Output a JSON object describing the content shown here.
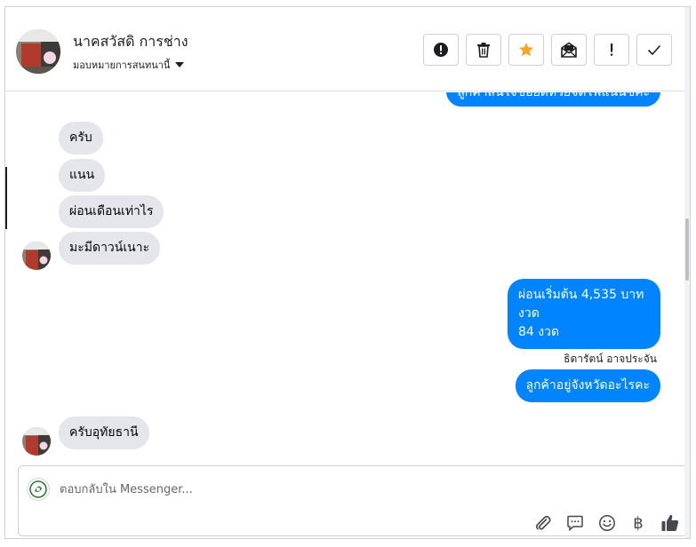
{
  "header": {
    "contact_name": "นาคสวัสดิ การช่าง",
    "assign_label": "มอบหมายการสนทนานี้",
    "tools": [
      "mark-spam",
      "delete",
      "star",
      "mark-unread",
      "follow-up",
      "done"
    ],
    "star_color": "#f5a623"
  },
  "messages": {
    "partial_out": "ลูกค้าสนใจขอยดหวยจดไฟแนนซคะ",
    "in_1": "ครับ",
    "in_2": "แนน",
    "in_3": "ผ่อนเดือนเท่าไร",
    "in_4": "มะมีดาวน์เนาะ",
    "out_1_line1": "ผ่อนเริ่มต้น 4,535 บาท",
    "out_1_line2": "งวด",
    "out_1_line3": "84 งวด",
    "out_sender": "ธิดารัตน์ อาจประจัน",
    "out_2": "ลูกค้าอยู่จังหวัดอะไรคะ",
    "in_5": "ครับอุทัยธานี"
  },
  "composer": {
    "placeholder": "ตอบกลับใน Messenger...",
    "baht_symbol": "฿"
  },
  "colors": {
    "outgoing": "#0084ff",
    "incoming": "#e4e6eb"
  }
}
